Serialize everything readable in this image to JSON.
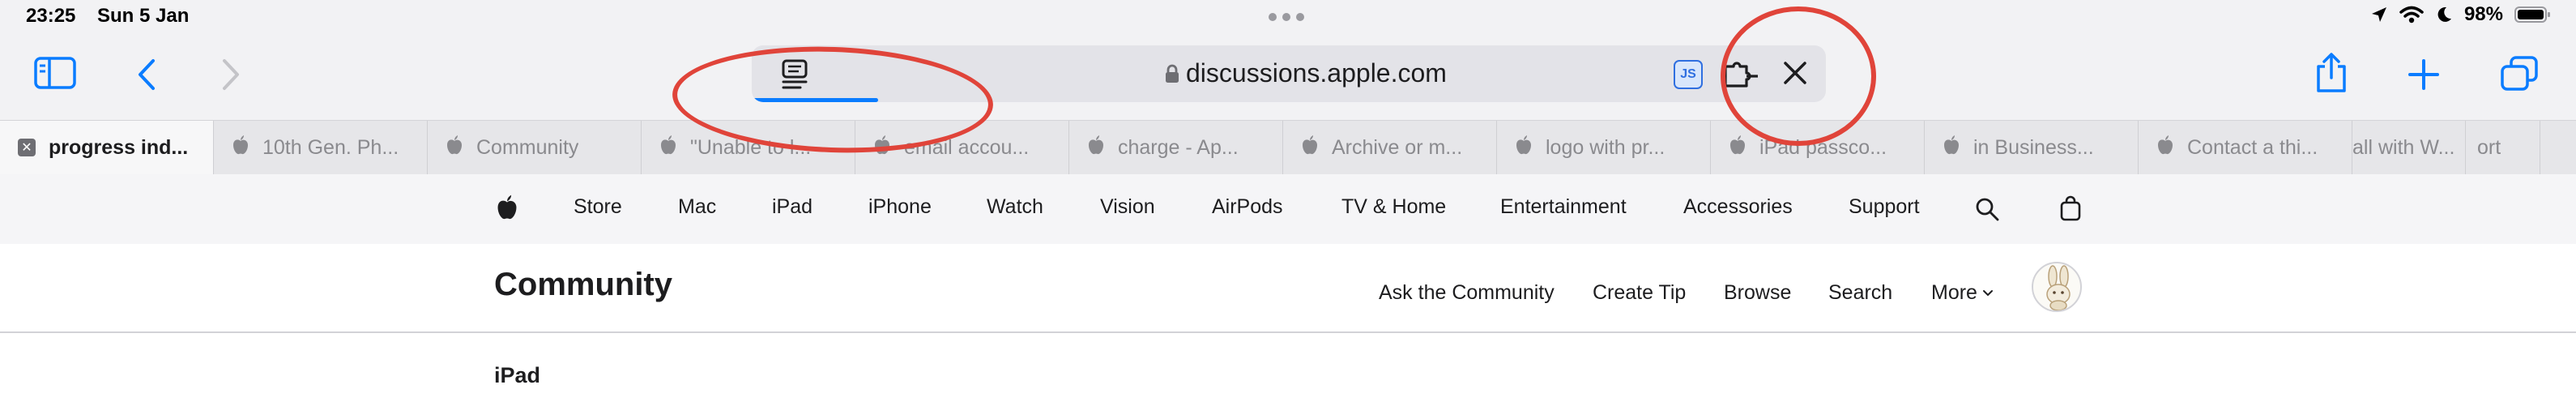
{
  "status_bar": {
    "time": "23:25",
    "date": "Sun 5 Jan",
    "battery": "98%"
  },
  "address_bar": {
    "url": "discussions.apple.com",
    "load_progress": 0.118,
    "js_badge": "JS"
  },
  "tabs": [
    {
      "label": "progress ind...",
      "active": true
    },
    {
      "label": "10th Gen. Ph..."
    },
    {
      "label": "Community"
    },
    {
      "label": "\"Unable to l..."
    },
    {
      "label": "email accou..."
    },
    {
      "label": "charge - Ap..."
    },
    {
      "label": "Archive or m..."
    },
    {
      "label": "logo with pr..."
    },
    {
      "label": "iPad passco..."
    },
    {
      "label": "in Business..."
    },
    {
      "label": "Contact a thi..."
    },
    {
      "label": "all with W..."
    },
    {
      "label": "ort"
    }
  ],
  "global_nav": {
    "items": [
      "Store",
      "Mac",
      "iPad",
      "iPhone",
      "Watch",
      "Vision",
      "AirPods",
      "TV & Home",
      "Entertainment",
      "Accessories",
      "Support"
    ]
  },
  "community": {
    "title": "Community",
    "links": [
      "Ask the Community",
      "Create Tip",
      "Browse",
      "Search",
      "More"
    ]
  },
  "breadcrumb": "iPad",
  "colors": {
    "accent": "#0a7cff",
    "annotation": "#e0443a",
    "chrome_bg": "#f2f2f4",
    "nav_bg": "#f5f5f7"
  },
  "icons": {
    "sidebar": "sidebar-icon",
    "back": "back-chevron-icon",
    "forward": "forward-chevron-icon",
    "reader": "reader-icon",
    "lock": "lock-icon",
    "extension": "puzzle-extension-icon",
    "close": "close-icon",
    "share": "share-icon",
    "new_tab": "plus-icon",
    "tabs_overview": "tabs-overview-icon"
  }
}
